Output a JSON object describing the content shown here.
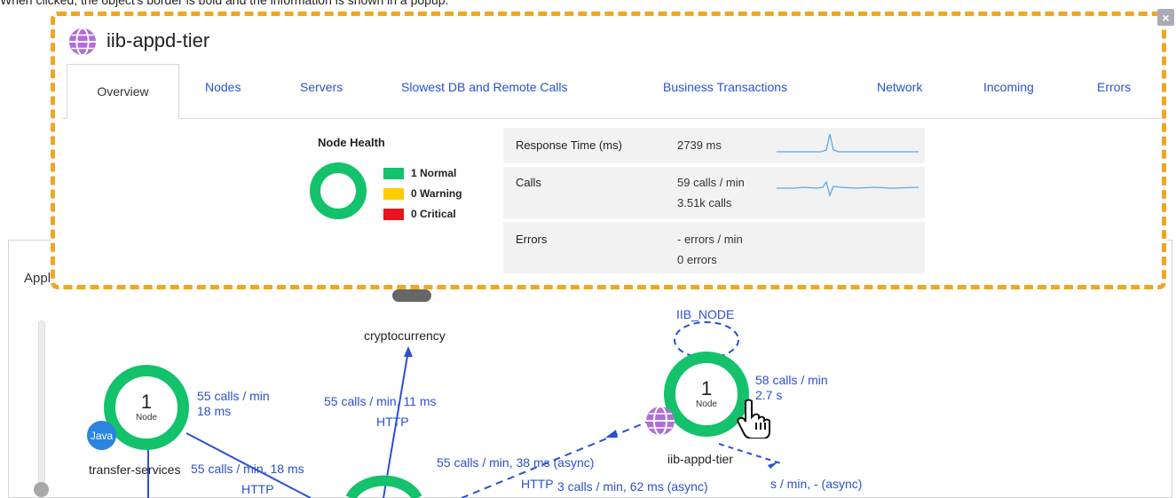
{
  "top_note": "When clicked, the object's border is bold and the information is shown in a popup.",
  "flow_panel": {
    "header": "Application Flow Map"
  },
  "flow_nodes": [
    {
      "count": "1",
      "sub": "Node",
      "name": "transfer-services",
      "badge": "Java"
    },
    {
      "count": "1",
      "sub": "Node",
      "name": "iib-appd-tier",
      "badge": "globe-icon"
    }
  ],
  "flow_labels": {
    "transfer_calls": "55 calls / min",
    "transfer_time": "18 ms",
    "crypto_name": "cryptocurrency",
    "crypto_calls": "55 calls / min, 11 ms",
    "crypto_proto": "HTTP",
    "iib_node": "IIB_NODE",
    "iib_calls": "58 calls / min",
    "iib_time": "2.7 s",
    "async_calls": "55 calls / min, 38 ms (async)",
    "transfer_edge": "55 calls / min, 18 ms",
    "transfer_proto": "HTTP",
    "bottom_edge1": "HTTP",
    "bottom_edge2": "3 calls / min, 62 ms (async)",
    "bottom_edge3": "s / min, - (async)"
  },
  "popup": {
    "title": "iib-appd-tier",
    "close_label": "×",
    "tabs": [
      {
        "label": "Overview",
        "active": true
      },
      {
        "label": "Nodes"
      },
      {
        "label": "Servers"
      },
      {
        "label": "Slowest DB and Remote Calls"
      },
      {
        "label": "Business Transactions"
      },
      {
        "label": "Network"
      },
      {
        "label": "Incoming"
      },
      {
        "label": "Errors"
      }
    ],
    "node_health": {
      "title": "Node Health",
      "normal": "1 Normal",
      "warning": "0 Warning",
      "critical": "0 Critical",
      "colors": {
        "normal": "#13c26b",
        "warning": "#ffcc00",
        "critical": "#e8141e"
      }
    },
    "metrics": [
      {
        "label": "Response Time (ms)",
        "line1": "2739 ms",
        "line2": ""
      },
      {
        "label": "Calls",
        "line1": "59 calls / min",
        "line2": "3.51k calls"
      },
      {
        "label": "Errors",
        "line1": "- errors / min",
        "line2": "0 errors"
      }
    ]
  },
  "colors": {
    "accent": "#2b50d2",
    "node_green": "#13c26b",
    "popup_border": "#f0a623"
  }
}
